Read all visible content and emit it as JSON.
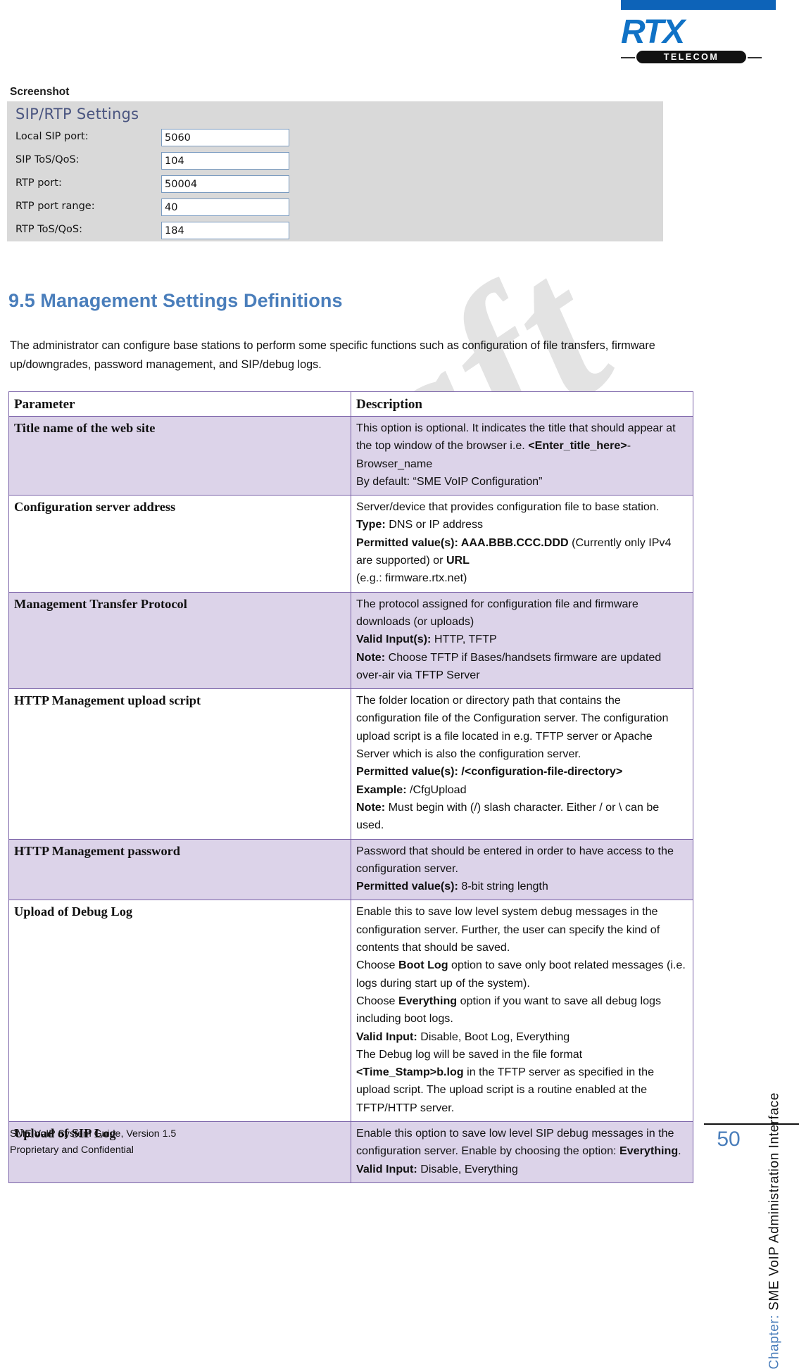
{
  "header": {
    "logo": {
      "brand": "RTX",
      "sub": "TELECOM",
      "bar_color": "#0d63b8",
      "brand_color": "#1072c6"
    }
  },
  "watermark": {
    "text": "Draft"
  },
  "screenshot": {
    "label": "Screenshot",
    "panel_title": "SIP/RTP Settings",
    "fields": [
      {
        "label": "Local SIP port:",
        "value": "5060"
      },
      {
        "label": "SIP ToS/QoS:",
        "value": "104"
      },
      {
        "label": "RTP port:",
        "value": "50004"
      },
      {
        "label": "RTP port range:",
        "value": "40"
      },
      {
        "label": "RTP ToS/QoS:",
        "value": "184"
      }
    ]
  },
  "section": {
    "number": "9.5",
    "heading": "9.5 Management Settings Definitions",
    "intro": "The administrator can configure base stations to perform some specific functions such as configuration of file transfers, firmware up/downgrades, password management, and SIP/debug logs."
  },
  "table": {
    "headers": [
      "Parameter",
      "Description"
    ],
    "rows": [
      {
        "param": "Title name of the web site",
        "shaded": true,
        "lines": [
          [
            {
              "t": "This option is optional. It indicates the title that should appear at the top window of the browser i.e. "
            },
            {
              "t": "<Enter_title_here>",
              "b": true
            },
            {
              "t": "-Browser_name"
            }
          ],
          [
            {
              "t": "By default: “SME VoIP Configuration”"
            }
          ]
        ]
      },
      {
        "param": "Configuration server address",
        "shaded": false,
        "lines": [
          [
            {
              "t": "Server/device that provides configuration file to base station."
            }
          ],
          [
            {
              "t": "Type:",
              "b": true
            },
            {
              "t": " DNS or IP address"
            }
          ],
          [
            {
              "t": "Permitted value(s): AAA.BBB.CCC.DDD",
              "b": true
            },
            {
              "t": " (Currently only IPv4 are supported) or "
            },
            {
              "t": "URL",
              "b": true
            }
          ],
          [
            {
              "t": " (e.g.: firmware.rtx.net)"
            }
          ]
        ]
      },
      {
        "param": "Management Transfer Protocol",
        "shaded": true,
        "lines": [
          [
            {
              "t": "The protocol assigned for configuration file and firmware downloads (or uploads)"
            }
          ],
          [
            {
              "t": "Valid Input(s):",
              "b": true
            },
            {
              "t": " HTTP, TFTP"
            }
          ],
          [
            {
              "t": "Note:",
              "b": true
            },
            {
              "t": " Choose TFTP if Bases/handsets firmware are updated over-air via TFTP Server"
            }
          ]
        ]
      },
      {
        "param": "HTTP Management upload script",
        "shaded": false,
        "lines": [
          [
            {
              "t": "The folder location or directory path that contains the configuration file of the Configuration server. The configuration upload script is a file located in e.g. TFTP server or Apache Server which is also the configuration server."
            }
          ],
          [
            {
              "t": "Permitted value(s): /<configuration-file-directory>",
              "b": true
            }
          ],
          [
            {
              "t": "Example:",
              "b": true
            },
            {
              "t": " /CfgUpload"
            }
          ],
          [
            {
              "t": "Note:",
              "b": true
            },
            {
              "t": " Must begin with (/) slash character. Either / or \\ can be used."
            }
          ]
        ]
      },
      {
        "param": "HTTP Management password",
        "shaded": true,
        "lines": [
          [
            {
              "t": "Password that should be entered in order to have access to the configuration server."
            }
          ],
          [
            {
              "t": "Permitted value(s):",
              "b": true
            },
            {
              "t": " 8-bit string length"
            }
          ]
        ]
      },
      {
        "param": "Upload of Debug Log",
        "shaded": false,
        "lines": [
          [
            {
              "t": "Enable this to save low level system debug messages in the configuration server. Further, the user can specify the kind of contents that should be saved."
            }
          ],
          [
            {
              "t": "Choose "
            },
            {
              "t": "Boot Log",
              "b": true
            },
            {
              "t": " option to save only boot related messages (i.e. logs during start up of the system)."
            }
          ],
          [
            {
              "t": "Choose "
            },
            {
              "t": "Everything",
              "b": true
            },
            {
              "t": " option if you want to save all debug logs including boot logs."
            }
          ],
          [
            {
              "t": "Valid Input:",
              "b": true
            },
            {
              "t": " Disable, Boot Log, Everything"
            }
          ],
          [
            {
              "t": "The Debug log will be saved in the file format "
            },
            {
              "t": "<Time_Stamp>b.log",
              "b": true
            },
            {
              "t": " in the TFTP server as specified in the upload script. The upload script is a routine enabled at the TFTP/HTTP server."
            }
          ]
        ]
      },
      {
        "param": "Upload of SIP Log",
        "shaded": true,
        "lines": [
          [
            {
              "t": "Enable this option to save low level SIP debug messages in the configuration server. Enable by choosing the option: "
            },
            {
              "t": "Everything",
              "b": true
            },
            {
              "t": "."
            }
          ],
          [
            {
              "t": "Valid Input:",
              "b": true
            },
            {
              "t": " Disable, Everything"
            }
          ]
        ]
      }
    ]
  },
  "sidebar": {
    "chapter_prefix": "Chapter: ",
    "chapter_title": "SME VoIP Administration Interface",
    "page_number": "50"
  },
  "footer": {
    "line1": "SME VoIP System Guide, Version 1.5",
    "line2": "Proprietary and Confidential"
  }
}
